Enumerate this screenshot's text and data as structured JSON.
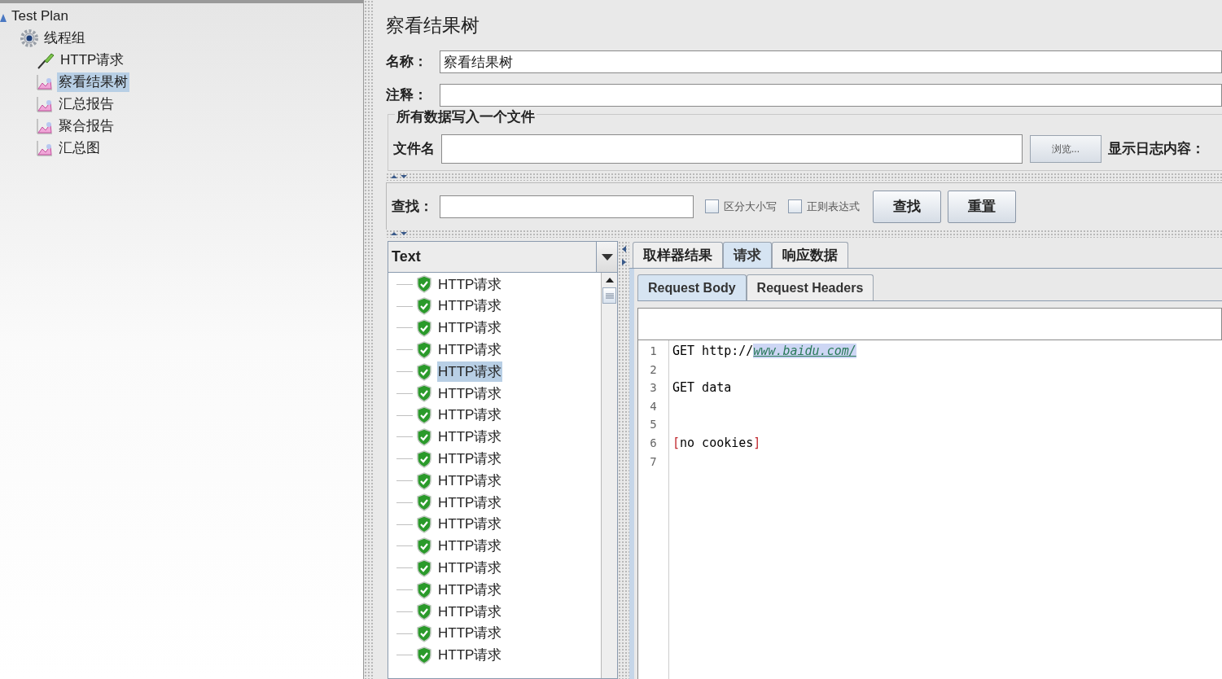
{
  "tree": [
    {
      "label": "Test Plan",
      "kind": "plan",
      "selected": false,
      "children": [
        {
          "label": "线程组",
          "kind": "group",
          "selected": false,
          "children": [
            {
              "label": "HTTP请求",
              "kind": "sampler",
              "selected": false
            },
            {
              "label": "察看结果树",
              "kind": "listener",
              "selected": true
            },
            {
              "label": "汇总报告",
              "kind": "listener",
              "selected": false
            },
            {
              "label": "聚合报告",
              "kind": "listener",
              "selected": false
            },
            {
              "label": "汇总图",
              "kind": "listener",
              "selected": false
            }
          ]
        }
      ]
    }
  ],
  "panel": {
    "title": "察看结果树",
    "name_label": "名称：",
    "name_value": "察看结果树",
    "comment_label": "注释：",
    "file_group": {
      "legend": "所有数据写入一个文件",
      "filename_label": "文件名",
      "browse_button": "浏览...",
      "log_label": "显示日志内容："
    },
    "search": {
      "label": "查找：",
      "options": [
        {
          "label": "区分大小写",
          "checked": false
        },
        {
          "label": "正则表达式",
          "checked": false
        }
      ],
      "buttons": [
        "查找",
        "重置"
      ]
    },
    "results": {
      "renderer": "Text",
      "items": [
        {
          "label": "HTTP请求",
          "selected": false
        },
        {
          "label": "HTTP请求",
          "selected": false
        },
        {
          "label": "HTTP请求",
          "selected": false
        },
        {
          "label": "HTTP请求",
          "selected": false
        },
        {
          "label": "HTTP请求",
          "selected": true
        },
        {
          "label": "HTTP请求",
          "selected": false
        },
        {
          "label": "HTTP请求",
          "selected": false
        },
        {
          "label": "HTTP请求",
          "selected": false
        },
        {
          "label": "HTTP请求",
          "selected": false
        },
        {
          "label": "HTTP请求",
          "selected": false
        },
        {
          "label": "HTTP请求",
          "selected": false
        },
        {
          "label": "HTTP请求",
          "selected": false
        },
        {
          "label": "HTTP请求",
          "selected": false
        },
        {
          "label": "HTTP请求",
          "selected": false
        },
        {
          "label": "HTTP请求",
          "selected": false
        },
        {
          "label": "HTTP请求",
          "selected": false
        },
        {
          "label": "HTTP请求",
          "selected": false
        },
        {
          "label": "HTTP请求",
          "selected": false
        }
      ]
    },
    "tabs": [
      {
        "label": "取样器结果",
        "selected": false
      },
      {
        "label": "请求",
        "selected": true
      },
      {
        "label": "响应数据",
        "selected": false
      }
    ],
    "subtabs": [
      {
        "label": "Request Body",
        "selected": true
      },
      {
        "label": "Request Headers",
        "selected": false
      }
    ],
    "code_lines": [
      {
        "number": "1",
        "segments": [
          {
            "text": "GET http://",
            "kind": "plain"
          },
          {
            "text": "www.baidu.com/",
            "kind": "link"
          }
        ]
      },
      {
        "number": "2"
      },
      {
        "number": "3",
        "segments": [
          {
            "text": "GET data",
            "kind": "plain"
          }
        ]
      },
      {
        "number": "4"
      },
      {
        "number": "5"
      },
      {
        "number": "6",
        "segments": [
          {
            "text": "[",
            "kind": "bracket"
          },
          {
            "text": "no cookies",
            "kind": "plain"
          },
          {
            "text": "]",
            "kind": "bracket"
          }
        ]
      },
      {
        "number": "7"
      }
    ]
  }
}
